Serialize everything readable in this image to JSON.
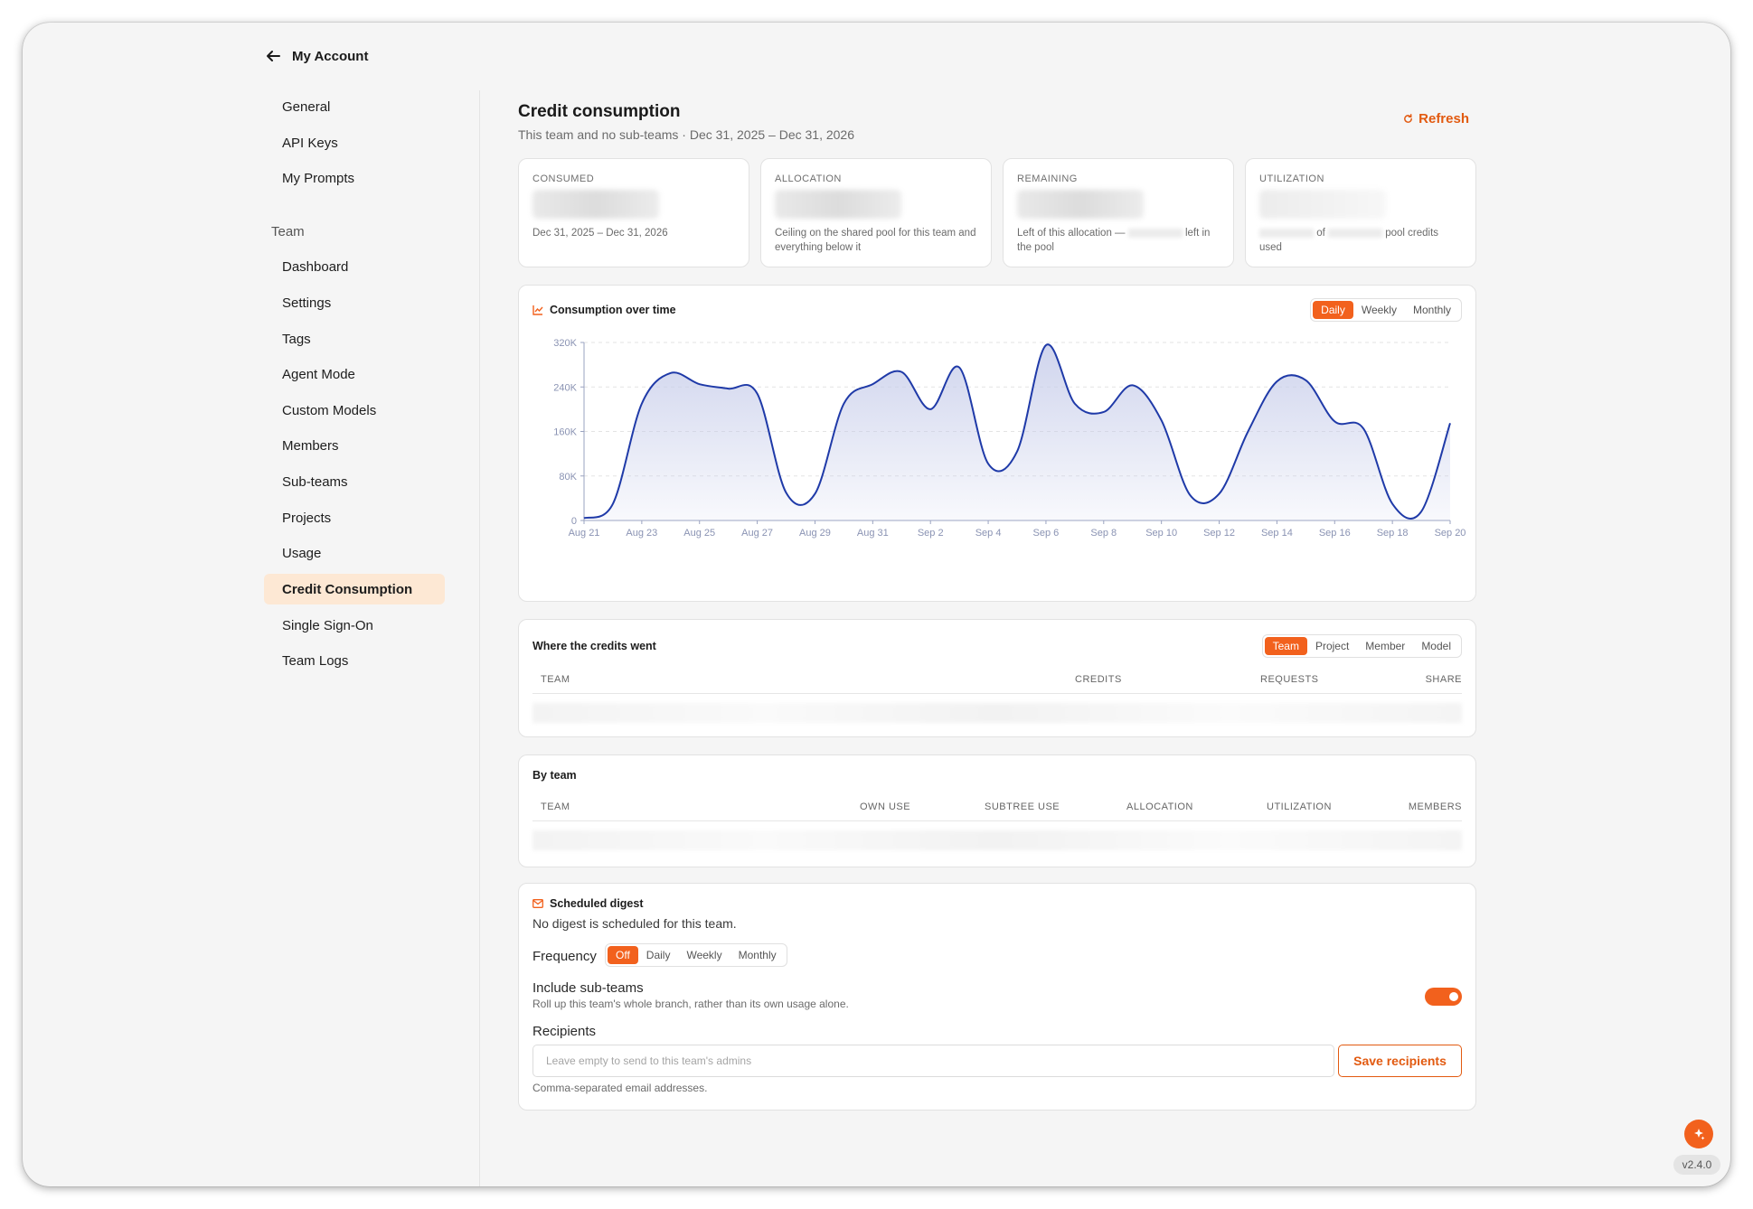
{
  "sidebar": {
    "back_label": "My Account",
    "account_items": [
      "General",
      "API Keys",
      "My Prompts"
    ],
    "team_section": "Team",
    "team_items": [
      "Dashboard",
      "Settings",
      "Tags",
      "Agent Mode",
      "Custom Models",
      "Members",
      "Sub-teams",
      "Projects",
      "Usage",
      "Credit Consumption",
      "Single Sign-On",
      "Team Logs"
    ],
    "active_item": "Credit Consumption"
  },
  "header": {
    "title": "Credit consumption",
    "subtitle": "This team and no sub-teams · Dec 31, 2025 – Dec 31, 2026",
    "refresh_label": "Refresh"
  },
  "stats": {
    "consumed": {
      "label": "CONSUMED",
      "note": "Dec 31, 2025 – Dec 31, 2026"
    },
    "allocation": {
      "label": "ALLOCATION",
      "note": "Ceiling on the shared pool for this team and everything below it"
    },
    "remaining": {
      "label": "REMAINING",
      "note_a": "Left of this allocation —",
      "note_b": "left",
      "note_c": "in the pool"
    },
    "utilization": {
      "label": "UTILIZATION",
      "note_a": "of",
      "note_b": "pool credits",
      "note_c": "used"
    }
  },
  "consumption": {
    "title": "Consumption over time",
    "tabs": [
      "Daily",
      "Weekly",
      "Monthly"
    ],
    "active_tab": "Daily"
  },
  "chart_data": {
    "type": "area",
    "title": "Consumption over time",
    "xlabel": "",
    "ylabel": "",
    "ylim": [
      0,
      320000
    ],
    "y_ticks": [
      "0",
      "80K",
      "160K",
      "240K",
      "320K"
    ],
    "y_tick_values": [
      0,
      80000,
      160000,
      240000,
      320000
    ],
    "x_tick_labels": [
      "Aug 21",
      "Aug 23",
      "Aug 25",
      "Aug 27",
      "Aug 29",
      "Aug 31",
      "Sep 2",
      "Sep 4",
      "Sep 6",
      "Sep 8",
      "Sep 10",
      "Sep 12",
      "Sep 14",
      "Sep 16",
      "Sep 18",
      "Sep 20"
    ],
    "x": [
      "Aug 21",
      "Aug 22",
      "Aug 23",
      "Aug 24",
      "Aug 25",
      "Aug 26",
      "Aug 27",
      "Aug 28",
      "Aug 29",
      "Aug 30",
      "Aug 31",
      "Sep 1",
      "Sep 2",
      "Sep 3",
      "Sep 4",
      "Sep 5",
      "Sep 6",
      "Sep 7",
      "Sep 8",
      "Sep 9",
      "Sep 10",
      "Sep 11",
      "Sep 12",
      "Sep 13",
      "Sep 14",
      "Sep 15",
      "Sep 16",
      "Sep 17",
      "Sep 18",
      "Sep 19",
      "Sep 20"
    ],
    "series": [
      {
        "values": [
          4000,
          30000,
          210000,
          265000,
          245000,
          237000,
          228000,
          50000,
          48000,
          210000,
          245000,
          267000,
          200000,
          275000,
          102000,
          124000,
          315000,
          210000,
          195000,
          243000,
          180000,
          45000,
          48000,
          160000,
          250000,
          252000,
          178000,
          165000,
          30000,
          16000,
          175000
        ]
      }
    ],
    "grid": true,
    "line_color": "#1f3aa8",
    "fill_color": "#c7cdea"
  },
  "credits_went": {
    "title": "Where the credits went",
    "tabs": [
      "Team",
      "Project",
      "Member",
      "Model"
    ],
    "active_tab": "Team",
    "columns": [
      "TEAM",
      "CREDITS",
      "REQUESTS",
      "SHARE"
    ]
  },
  "by_team": {
    "title": "By team",
    "columns": [
      "TEAM",
      "OWN USE",
      "SUBTREE USE",
      "ALLOCATION",
      "UTILIZATION",
      "MEMBERS"
    ]
  },
  "digest": {
    "title": "Scheduled digest",
    "status": "No digest is scheduled for this team.",
    "frequency_label": "Frequency",
    "frequency_options": [
      "Off",
      "Daily",
      "Weekly",
      "Monthly"
    ],
    "frequency_active": "Off",
    "include_label": "Include sub-teams",
    "include_desc": "Roll up this team's whole branch, rather than its own usage alone.",
    "include_on": true,
    "recipients_label": "Recipients",
    "recipients_placeholder": "Leave empty to send to this team's admins",
    "save_label": "Save recipients",
    "help": "Comma-separated email addresses."
  },
  "version": "v2.4.0",
  "colors": {
    "accent": "#f2611d",
    "accent_text": "#e25a10",
    "active_bg": "#fde8d4",
    "chart_line": "#1f3aa8"
  },
  "icons": {
    "back": "arrow-left-icon",
    "refresh": "refresh-icon",
    "chart": "trend-chart-icon",
    "mail": "mail-icon",
    "assistant": "sparkle-icon"
  }
}
